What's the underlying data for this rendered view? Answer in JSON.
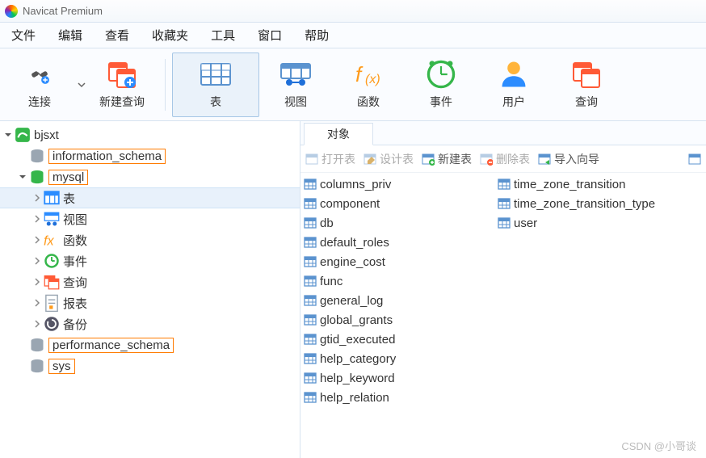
{
  "title": "Navicat Premium",
  "menu": [
    "文件",
    "编辑",
    "查看",
    "收藏夹",
    "工具",
    "窗口",
    "帮助"
  ],
  "toolbar": {
    "connect": "连接",
    "new_query": "新建查询",
    "table": "表",
    "view": "视图",
    "function": "函数",
    "event": "事件",
    "user": "用户",
    "query": "查询"
  },
  "tree": {
    "connection": "bjsxt",
    "db_info": "information_schema",
    "db_mysql": "mysql",
    "sub_table": "表",
    "sub_view": "视图",
    "sub_function": "函数",
    "sub_event": "事件",
    "sub_query": "查询",
    "sub_report": "报表",
    "sub_backup": "备份",
    "db_perf": "performance_schema",
    "db_sys": "sys"
  },
  "tab_label": "对象",
  "objbar": {
    "open": "打开表",
    "design": "设计表",
    "new": "新建表",
    "delete": "删除表",
    "import": "导入向导"
  },
  "tables_col1": [
    "columns_priv",
    "component",
    "db",
    "default_roles",
    "engine_cost",
    "func",
    "general_log",
    "global_grants",
    "gtid_executed",
    "help_category",
    "help_keyword",
    "help_relation"
  ],
  "tables_col2": [
    "time_zone_transition",
    "time_zone_transition_type",
    "user"
  ],
  "watermark": "CSDN @小哥谈"
}
